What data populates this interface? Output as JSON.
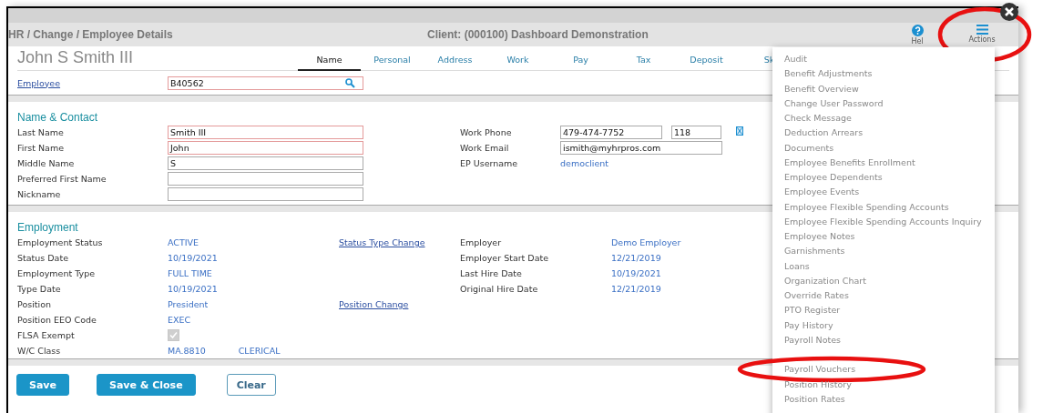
{
  "header": {
    "breadcrumb": "HR / Change / Employee Details",
    "client": "Client: (000100) Dashboard Demonstration",
    "help_label": "Hel",
    "actions_label": "Actions",
    "actions_highlight": true
  },
  "employee_name": "John S Smith III",
  "tabs": [
    {
      "label": "Name",
      "selected": true
    },
    {
      "label": "Personal",
      "selected": false
    },
    {
      "label": "Address",
      "selected": false
    },
    {
      "label": "Work",
      "selected": false
    },
    {
      "label": "Pay",
      "selected": false
    },
    {
      "label": "Tax",
      "selected": false
    },
    {
      "label": "Deposit",
      "selected": false
    },
    {
      "label": "Sk",
      "selected": false
    }
  ],
  "employee_lookup": {
    "label": "Employee",
    "value": "B40562",
    "required": true
  },
  "name_contact": {
    "title": "Name & Contact",
    "left": [
      {
        "label": "Last Name",
        "kind": "input",
        "value": "Smith III",
        "required": true
      },
      {
        "label": "First Name",
        "kind": "input",
        "value": "John",
        "required": true
      },
      {
        "label": "Middle Name",
        "kind": "input",
        "value": "S",
        "required": false
      },
      {
        "label": "Preferred First Name",
        "kind": "input",
        "required": false
      },
      {
        "label": "Nickname",
        "kind": "input",
        "required": false
      }
    ],
    "right": [
      {
        "label": "Work Phone",
        "kind": "phone",
        "value": "479-474-7752",
        "extension": "118"
      },
      {
        "label": "Work Email",
        "kind": "input",
        "value": "ismith@myhrpros.com"
      },
      {
        "label": "EP Username",
        "kind": "text",
        "value": "democlient"
      }
    ]
  },
  "employment": {
    "title": "Employment",
    "left": [
      {
        "label": "Employment Status",
        "kind": "text",
        "value": "ACTIVE",
        "link": "Status Type Change"
      },
      {
        "label": "Status Date",
        "kind": "text",
        "value": "10/19/2021"
      },
      {
        "label": "Employment Type",
        "kind": "text",
        "value": "FULL TIME"
      },
      {
        "label": "Type Date",
        "kind": "text",
        "value": "10/19/2021"
      },
      {
        "label": "Position",
        "kind": "text",
        "value": "President",
        "link": "Position Change"
      },
      {
        "label": "Position EEO Code",
        "kind": "text",
        "value": "EXEC"
      },
      {
        "label": "FLSA Exempt",
        "kind": "checkbox",
        "checked": true,
        "disabled": true
      },
      {
        "label": "W/C Class",
        "kind": "pair",
        "value": "MA.8810",
        "value_2": "CLERICAL"
      }
    ],
    "right": [
      {
        "label": "Employer",
        "value": "Demo Employer"
      },
      {
        "label": "Employer Start Date",
        "value": "12/21/2019"
      },
      {
        "label": "Last Hire Date",
        "value": "10/19/2021"
      },
      {
        "label": "Original Hire Date",
        "value": "12/21/2019"
      }
    ]
  },
  "buttons": [
    {
      "label": "Save",
      "kind": "primary"
    },
    {
      "label": "Save & Close",
      "kind": "primary"
    },
    {
      "label": "Clear",
      "kind": "outline"
    }
  ],
  "actions_menu": {
    "items": [
      {
        "label": "Audit",
        "highlight": false
      },
      {
        "label": "Benefit Adjustments",
        "highlight": false
      },
      {
        "label": "Benefit Overview",
        "highlight": false
      },
      {
        "label": "Change User Password",
        "highlight": false
      },
      {
        "label": "Check Message",
        "highlight": false
      },
      {
        "label": "Deduction Arrears",
        "highlight": false
      },
      {
        "label": "Documents",
        "highlight": false
      },
      {
        "label": "Employee Benefits Enrollment",
        "highlight": false
      },
      {
        "label": "Employee Dependents",
        "highlight": false
      },
      {
        "label": "Employee Events",
        "highlight": false
      },
      {
        "label": "Employee Flexible Spending Accounts",
        "highlight": false
      },
      {
        "label": "Employee Flexible Spending Accounts Inquiry",
        "highlight": false
      },
      {
        "label": "Employee Notes",
        "highlight": false
      },
      {
        "label": "Garnishments",
        "highlight": false
      },
      {
        "label": "Loans",
        "highlight": false
      },
      {
        "label": "Organization Chart",
        "highlight": false
      },
      {
        "label": "Override Rates",
        "highlight": false
      },
      {
        "label": "PTO Register",
        "highlight": false
      },
      {
        "label": "Pay History",
        "highlight": false
      },
      {
        "label": "Payroll Notes",
        "highlight": false
      },
      {
        "label": "Payroll Vouchers",
        "highlight": true,
        "gap_before": true
      },
      {
        "label": "Position History",
        "highlight": false
      },
      {
        "label": "Position Rates",
        "highlight": false
      }
    ]
  }
}
